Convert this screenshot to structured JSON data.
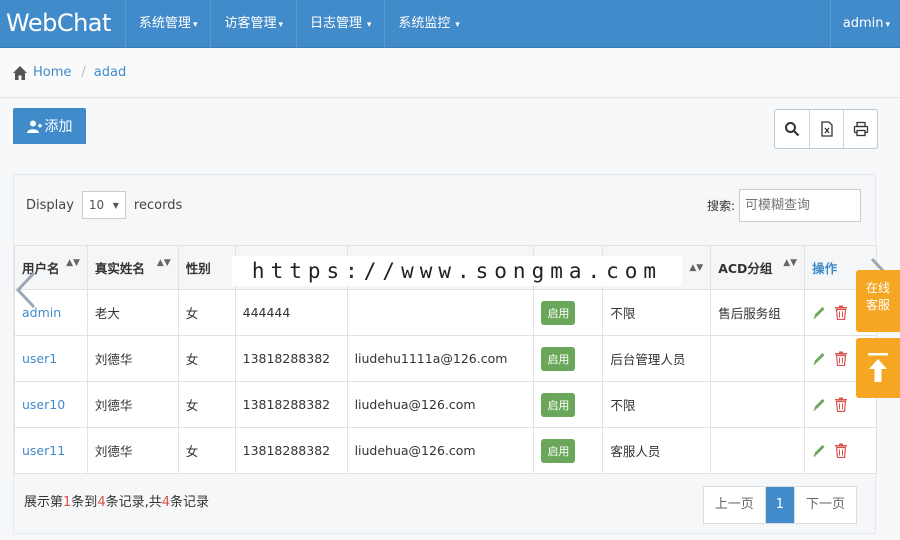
{
  "navbar": {
    "brand": "WebChat",
    "menus": [
      "系统管理",
      "访客管理",
      "日志管理",
      "系统监控"
    ],
    "user": "admin"
  },
  "breadcrumb": {
    "home": "Home",
    "current": "adad"
  },
  "toolbar": {
    "add_label": "添加",
    "tools": [
      "search-icon",
      "export-icon",
      "print-icon"
    ]
  },
  "filters": {
    "display_label": "Display",
    "page_size": "10",
    "records_label": "records",
    "search_label": "搜索:",
    "search_placeholder": "可模糊查询"
  },
  "table": {
    "headers": [
      "用户名",
      "真实姓名",
      "性别",
      "",
      "",
      "",
      "",
      "ACD分组",
      "操作"
    ],
    "rows": [
      {
        "username": "admin",
        "realname": "老大",
        "gender": "女",
        "phone": "444444",
        "email": "",
        "status": "启用",
        "scope": "不限",
        "acd": "售后服务组"
      },
      {
        "username": "user1",
        "realname": "刘德华",
        "gender": "女",
        "phone": "13818288382",
        "email": "liudehu1111a@126.com",
        "status": "启用",
        "scope": "后台管理人员",
        "acd": ""
      },
      {
        "username": "user10",
        "realname": "刘德华",
        "gender": "女",
        "phone": "13818288382",
        "email": "liudehua@126.com",
        "status": "启用",
        "scope": "不限",
        "acd": ""
      },
      {
        "username": "user11",
        "realname": "刘德华",
        "gender": "女",
        "phone": "13818288382",
        "email": "liudehua@126.com",
        "status": "启用",
        "scope": "客服人员",
        "acd": ""
      }
    ]
  },
  "summary": {
    "prefix": "展示第",
    "from": "1",
    "mid1": "条到",
    "to": "4",
    "mid2": "条记录,共",
    "total": "4",
    "suffix": "条记录"
  },
  "pagination": {
    "prev": "上一页",
    "current": "1",
    "next": "下一页"
  },
  "watermark": "https://www.songma.com",
  "float": {
    "service_line1": "在线",
    "service_line2": "客服"
  },
  "colors": {
    "primary": "#428bca",
    "success": "#6aa75a",
    "danger": "#d9534f",
    "float": "#f5a623"
  }
}
